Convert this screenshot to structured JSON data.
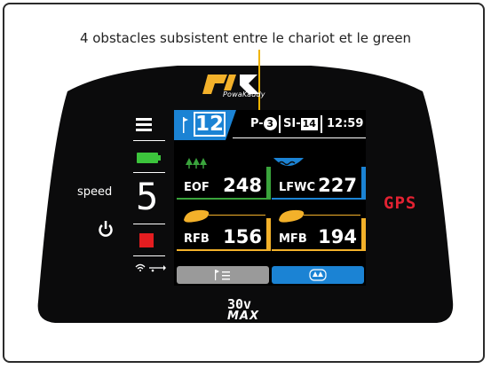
{
  "caption": "4 obstacles subsistent entre le chariot et le green",
  "brand": {
    "name": "PowaKaddy",
    "model_line1": "30v",
    "model_line2": "MAX"
  },
  "side": {
    "speed_label": "speed",
    "speed_value": "5",
    "gps_label": "GPS"
  },
  "status": {
    "hole": "12",
    "par_prefix": "P-",
    "par_value": "3",
    "si_prefix": "SI-",
    "si_value": "14",
    "time": "12:59"
  },
  "tiles": [
    {
      "label": "EOF",
      "value": "248",
      "color": "#3aa43c",
      "icon": "trees-icon"
    },
    {
      "label": "LFWC",
      "value": "227",
      "color": "#1b83d4",
      "icon": "water-icon"
    },
    {
      "label": "RFB",
      "value": "156",
      "color": "#f3b12a",
      "icon": "bunker-icon"
    },
    {
      "label": "MFB",
      "value": "194",
      "color": "#f3b12a",
      "icon": "bunker-icon"
    }
  ],
  "buttons": {
    "left_icon": "flag-list-icon",
    "right_icon": "trees-circle-icon"
  },
  "colors": {
    "accent_blue": "#1b83d4",
    "battery_green": "#3cc43c",
    "stop_red": "#e41d20",
    "pointer": "#f0b400"
  }
}
